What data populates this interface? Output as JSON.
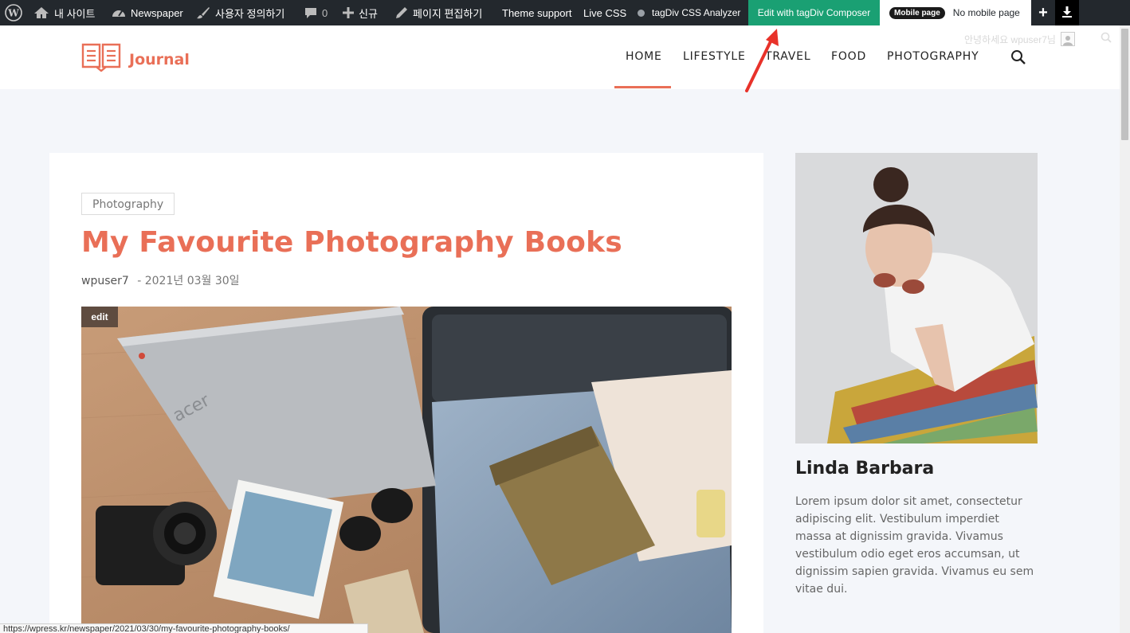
{
  "adminbar": {
    "site_label": "내 사이트",
    "newspaper_label": "Newspaper",
    "customize_label": "사용자 정의하기",
    "comments_count": "0",
    "new_label": "신규",
    "edit_page_label": "페이지 편집하기",
    "theme_support_label": "Theme support",
    "live_css_label": "Live CSS",
    "css_analyzer_label": "tagDiv CSS Analyzer",
    "composer_label": "Edit with tagDiv Composer",
    "mobile_pill": "Mobile page",
    "no_mobile_label": "No mobile page",
    "plus_label": "+"
  },
  "header": {
    "logo_text": "Journal",
    "greeting": "안녕하세요 wpuser7님",
    "nav": [
      "HOME",
      "LIFESTYLE",
      "TRAVEL",
      "FOOD",
      "PHOTOGRAPHY"
    ],
    "active_nav": "HOME"
  },
  "post": {
    "category": "Photography",
    "title": "My Favourite Photography Books",
    "author": "wpuser7",
    "date": "- 2021년 03월 30일",
    "edit_label": "edit"
  },
  "sidebar": {
    "author_name": "Linda Barbara",
    "bio": "Lorem ipsum dolor sit amet, consectetur adipiscing elit. Vestibulum imperdiet massa at dignissim gravida. Vivamus vestibulum odio eget eros accumsan, ut dignissim sapien gravida. Vivamus eu sem vitae dui."
  },
  "statusbar": {
    "url": "https://wpress.kr/newspaper/2021/03/30/my-favourite-photography-books/"
  },
  "colors": {
    "accent": "#e96f57",
    "admin_bg": "#23282d",
    "composer_green": "#1aa073",
    "page_bg": "#f4f6fa"
  }
}
